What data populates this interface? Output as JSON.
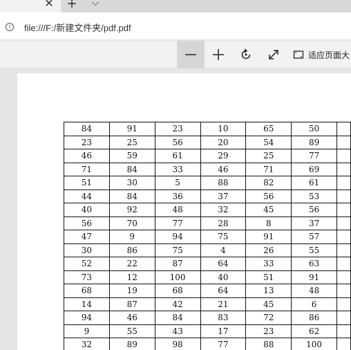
{
  "browser": {
    "tab_close": "✕",
    "new_tab": "+",
    "tab_list": "⌵"
  },
  "address": {
    "info_icon": "i",
    "url": "file:///F:/新建文件夹/pdf.pdf"
  },
  "pdf_toolbar": {
    "fit_page_label": "适应页面大"
  },
  "table": {
    "rows": [
      [
        "84",
        "91",
        "23",
        "10",
        "65",
        "50"
      ],
      [
        "23",
        "25",
        "56",
        "20",
        "54",
        "89"
      ],
      [
        "46",
        "59",
        "61",
        "29",
        "25",
        "77"
      ],
      [
        "71",
        "84",
        "33",
        "46",
        "71",
        "69"
      ],
      [
        "51",
        "30",
        "5",
        "88",
        "82",
        "61"
      ],
      [
        "44",
        "84",
        "36",
        "37",
        "56",
        "53"
      ],
      [
        "40",
        "92",
        "48",
        "32",
        "45",
        "56"
      ],
      [
        "56",
        "70",
        "77",
        "28",
        "8",
        "37"
      ],
      [
        "47",
        "9",
        "94",
        "75",
        "91",
        "57"
      ],
      [
        "30",
        "86",
        "75",
        "4",
        "26",
        "55"
      ],
      [
        "52",
        "22",
        "87",
        "64",
        "33",
        "63"
      ],
      [
        "73",
        "12",
        "100",
        "40",
        "51",
        "91"
      ],
      [
        "68",
        "19",
        "68",
        "64",
        "13",
        "48"
      ],
      [
        "14",
        "87",
        "42",
        "21",
        "45",
        "6"
      ],
      [
        "94",
        "46",
        "84",
        "83",
        "72",
        "86"
      ],
      [
        "9",
        "55",
        "43",
        "17",
        "23",
        "62"
      ],
      [
        "32",
        "89",
        "98",
        "77",
        "88",
        "100"
      ]
    ]
  }
}
